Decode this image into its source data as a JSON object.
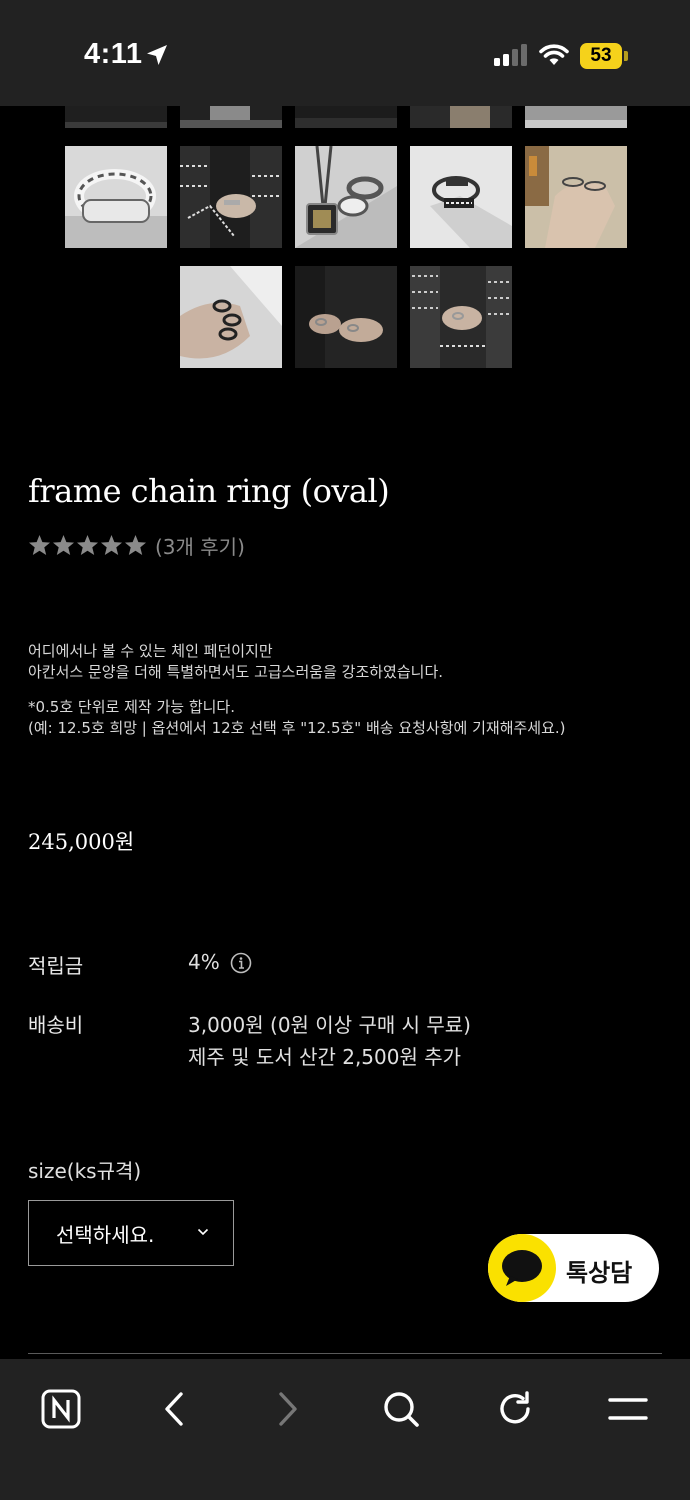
{
  "status_bar": {
    "time": "4:11",
    "battery": "53",
    "location_icon": "location-arrow-icon",
    "signal_icon": "cellular-signal-icon",
    "wifi_icon": "wifi-icon"
  },
  "gallery": {
    "thumbnails_partial": [
      {
        "label": "product-photo-1",
        "tone": "#1f1f1f"
      },
      {
        "label": "product-photo-2",
        "tone": "#2a2a2a"
      },
      {
        "label": "product-photo-3",
        "tone": "#1c1c1c"
      },
      {
        "label": "product-photo-4",
        "tone": "#383838"
      },
      {
        "label": "product-photo-5",
        "tone": "#9a9a9a"
      }
    ],
    "thumbnails_row2": [
      {
        "label": "ring-closeup-photo",
        "tone": "#d8d8d8"
      },
      {
        "label": "hands-jacket-photo",
        "tone": "#2b2b2b"
      },
      {
        "label": "necklace-ring-photo",
        "tone": "#cfcfcf"
      },
      {
        "label": "ring-on-table-photo",
        "tone": "#e6e6e6"
      },
      {
        "label": "hand-wall-photo",
        "tone": "#b8a992"
      }
    ],
    "thumbnails_row3": [
      {
        "label": "hand-rings-white-photo",
        "tone": "#cfcfcf"
      },
      {
        "label": "hands-dark-photo",
        "tone": "#2a2a2a"
      },
      {
        "label": "hands-tweed-photo",
        "tone": "#3a3a3a"
      }
    ]
  },
  "product": {
    "title": "frame chain ring (oval)",
    "review_count": "(3개 후기)",
    "rating": 5,
    "desc_lines": [
      "어디에서나 볼 수 있는 체인 페던이지만",
      "아칸서스 문양을 더해 특별하면서도 고급스러움을 강조하였습니다.",
      "*0.5호 단위로 제작 가능 합니다.",
      "(예: 12.5호 희망 | 옵션에서 12호 선택 후 \"12.5호\" 배송 요청사항에 기재해주세요.)"
    ],
    "price": "245,000원",
    "points_label": "적립금",
    "points_value": "4%",
    "shipping_label": "배송비",
    "shipping_value_1": "3,000원 (0원 이상 구매 시 무료)",
    "shipping_value_2": "제주 및 도서 산간 2,500원 추가",
    "size_label": "size(ks규격)",
    "size_select_value": "선택하세요."
  },
  "kakao": {
    "label": "톡상담",
    "color": "#fae100"
  },
  "bottom_nav": {
    "icons": [
      "naver-home-icon",
      "back-icon",
      "forward-icon",
      "search-icon",
      "refresh-icon",
      "menu-icon"
    ]
  }
}
